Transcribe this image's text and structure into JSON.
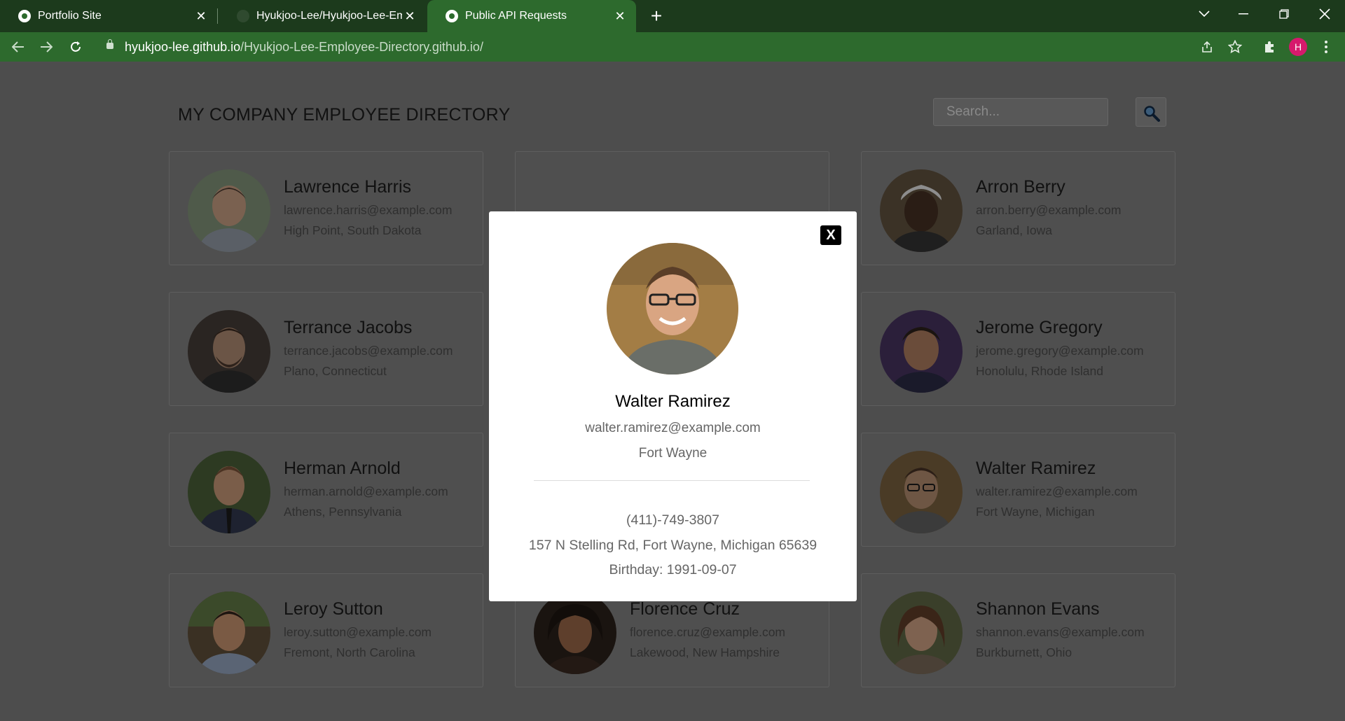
{
  "browser": {
    "tabs": [
      {
        "title": "Portfolio Site",
        "close": "✕"
      },
      {
        "title": "Hyukjoo-Lee/Hyukjoo-Lee-Emplo",
        "close": "✕"
      },
      {
        "title": "Public API Requests",
        "close": "✕"
      }
    ],
    "new_tab": "+",
    "url_host": "hyukjoo-lee.github.io",
    "url_path": "/Hyukjoo-Lee-Employee-Directory.github.io/",
    "profile_initial": "H",
    "accent": "#2d6a2d"
  },
  "page": {
    "title": "MY COMPANY EMPLOYEE DIRECTORY",
    "search_placeholder": "Search..."
  },
  "employees": [
    {
      "name": "Lawrence Harris",
      "email": "lawrence.harris@example.com",
      "location": "High Point, South Dakota"
    },
    {
      "name": "",
      "email": "",
      "location": ""
    },
    {
      "name": "Arron Berry",
      "email": "arron.berry@example.com",
      "location": "Garland, Iowa"
    },
    {
      "name": "Terrance Jacobs",
      "email": "terrance.jacobs@example.com",
      "location": "Plano, Connecticut"
    },
    {
      "name": "",
      "email": "",
      "location": ""
    },
    {
      "name": "Jerome Gregory",
      "email": "jerome.gregory@example.com",
      "location": "Honolulu, Rhode Island"
    },
    {
      "name": "Herman Arnold",
      "email": "herman.arnold@example.com",
      "location": "Athens, Pennsylvania"
    },
    {
      "name": "",
      "email": "",
      "location": ""
    },
    {
      "name": "Walter Ramirez",
      "email": "walter.ramirez@example.com",
      "location": "Fort Wayne, Michigan"
    },
    {
      "name": "Leroy Sutton",
      "email": "leroy.sutton@example.com",
      "location": "Fremont, North Carolina"
    },
    {
      "name": "Florence Cruz",
      "email": "florence.cruz@example.com",
      "location": "Lakewood, New Hampshire"
    },
    {
      "name": "Shannon Evans",
      "email": "shannon.evans@example.com",
      "location": "Burkburnett, Ohio"
    }
  ],
  "modal": {
    "close_label": "X",
    "name": "Walter Ramirez",
    "email": "walter.ramirez@example.com",
    "city": "Fort Wayne",
    "phone": "(411)-749-3807",
    "address": "157 N Stelling Rd, Fort Wayne, Michigan 65639",
    "birthday": "Birthday: 1991-09-07"
  }
}
